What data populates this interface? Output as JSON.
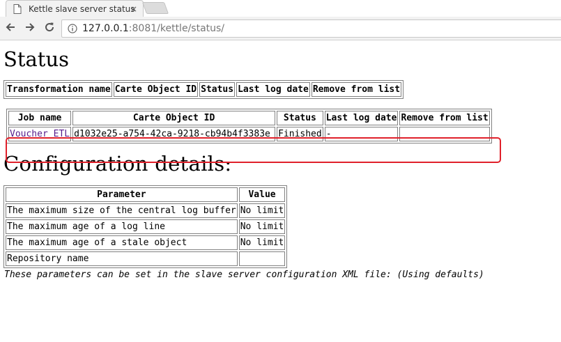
{
  "browser": {
    "tab_title": "Kettle slave server status",
    "tab_close": "×",
    "url_host": "127.0.0.1",
    "url_rest": ":8081/kettle/status/"
  },
  "status": {
    "heading": "Status",
    "transformations": {
      "headers": [
        "Transformation name",
        "Carte Object ID",
        "Status",
        "Last log date",
        "Remove from list"
      ]
    },
    "jobs": {
      "headers": [
        "Job name",
        "Carte Object ID",
        "Status",
        "Last log date",
        "Remove from list"
      ],
      "rows": [
        {
          "name": "Voucher ETL",
          "id": "d1032e25-a754-42ca-9218-cb94b4f3383e",
          "status": "Finished",
          "last_log": "-",
          "remove": ""
        }
      ]
    }
  },
  "config": {
    "heading": "Configuration details:",
    "headers": [
      "Parameter",
      "Value"
    ],
    "rows": [
      {
        "param": "The maximum size of the central log buffer",
        "value": "No limit"
      },
      {
        "param": "The maximum age of a log line",
        "value": "No limit"
      },
      {
        "param": "The maximum age of a stale object",
        "value": "No limit"
      },
      {
        "param": "Repository name",
        "value": ""
      }
    ],
    "footnote": "These parameters can be set in the slave server configuration XML file: (Using defaults)"
  },
  "colors": {
    "highlight": "#e0202a",
    "visited_link": "#551a8b"
  }
}
